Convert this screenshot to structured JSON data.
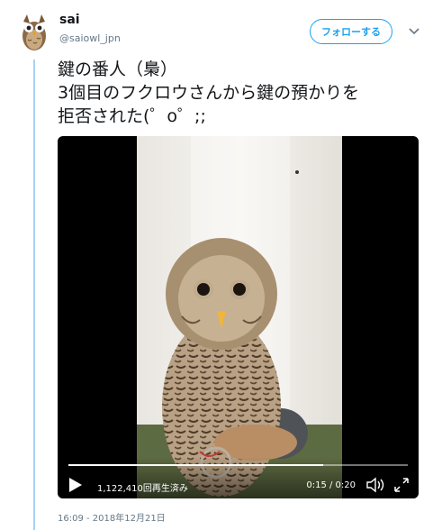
{
  "user": {
    "display_name": "sai",
    "handle": "@saiowl_jpn",
    "avatar_icon": "owl-icon"
  },
  "follow_button": {
    "label": "フォローする"
  },
  "tweet": {
    "lines": [
      "鍵の番人（梟）",
      "3個目のフクロウさんから鍵の預かりを",
      "拒否された(゜o゜;;"
    ]
  },
  "video": {
    "view_count": "1,122,410回再生済み",
    "time": "0:15 / 0:20",
    "progress_fraction": 0.75
  },
  "timestamp": "16:09 - 2018年12月21日",
  "colors": {
    "accent": "#1da1f2",
    "thread_line": "#a8d2f0",
    "secondary_text": "#657786"
  }
}
